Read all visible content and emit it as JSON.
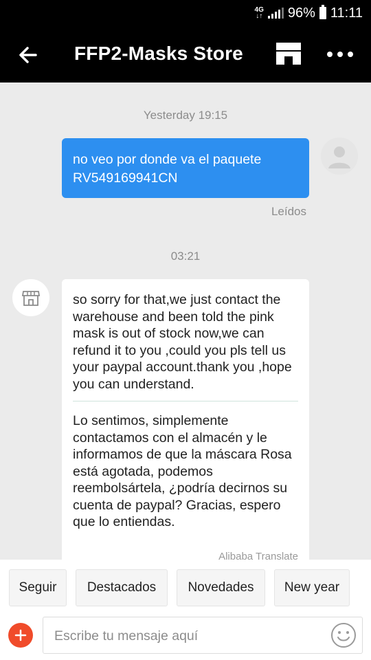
{
  "status_bar": {
    "network": "4G",
    "battery": "96%",
    "time": "11:11"
  },
  "header": {
    "title": "FFP2-Masks Store",
    "back_icon": "arrow-left-icon",
    "store_icon": "store-icon",
    "more_icon": "more-horizontal-icon"
  },
  "chat": {
    "messages": [
      {
        "timestamp": "Yesterday 19:15",
        "direction": "outgoing",
        "text": "no veo por donde va el paquete RV549169941CN",
        "status": "Leídos"
      },
      {
        "timestamp": "03:21",
        "direction": "incoming",
        "text": "so sorry for that,we just contact the warehouse and been told the pink mask is out of stock now,we can refund it to you ,could you pls tell us your paypal account.thank you ,hope you can understand.",
        "translation": "Lo sentimos, simplemente contactamos con el almacén y le informamos de que la máscara Rosa está agotada, podemos reembolsártela, ¿podría decirnos su cuenta de paypal? Gracias, espero que lo entiendas.",
        "translation_note": "Alibaba Translate"
      }
    ]
  },
  "quick_actions": [
    "Seguir",
    "Destacados",
    "Novedades",
    "New year"
  ],
  "composer": {
    "placeholder": "Escribe tu mensaje aquí",
    "value": ""
  },
  "colors": {
    "outgoing_bubble": "#2d8ff0",
    "header_bg": "#000000",
    "chat_bg": "#ebebeb",
    "add_button": "#f04b2a"
  }
}
